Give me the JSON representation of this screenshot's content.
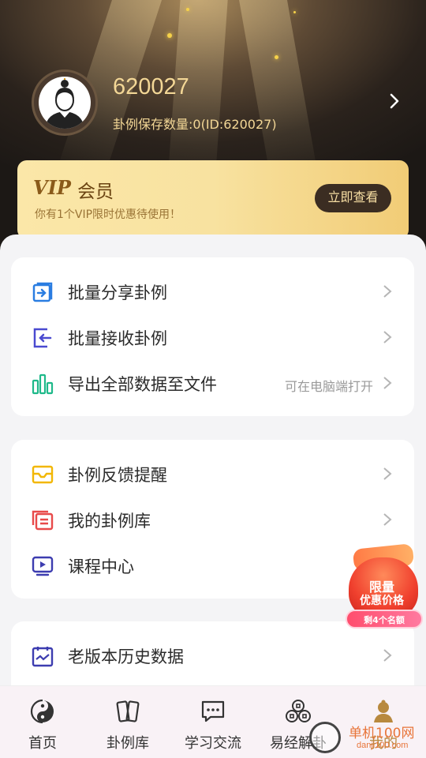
{
  "profile": {
    "username": "620027",
    "saved_info": "卦例保存数量:0(ID:620027)"
  },
  "vip": {
    "logo": "VIP",
    "title": "会员",
    "subtitle": "你有1个VIP限时优惠待使用！",
    "button_label": "立即查看"
  },
  "menu_group1": [
    {
      "label": "批量分享卦例",
      "hint": ""
    },
    {
      "label": "批量接收卦例",
      "hint": ""
    },
    {
      "label": "导出全部数据至文件",
      "hint": "可在电脑端打开"
    }
  ],
  "menu_group2": [
    {
      "label": "卦例反馈提醒"
    },
    {
      "label": "我的卦例库"
    },
    {
      "label": "课程中心"
    }
  ],
  "menu_group3": [
    {
      "label": "老版本历史数据"
    }
  ],
  "promo": {
    "line1": "限量",
    "line2": "优惠价格",
    "pill": "剩4个名额"
  },
  "tabs": [
    {
      "label": "首页",
      "icon": "taiji-icon"
    },
    {
      "label": "卦例库",
      "icon": "cards-icon"
    },
    {
      "label": "学习交流",
      "icon": "chat-icon"
    },
    {
      "label": "易经解卦",
      "icon": "coins-icon"
    },
    {
      "label": "我的",
      "icon": "person-icon",
      "active": true
    }
  ],
  "watermark": {
    "title": "单机100网",
    "url": "danji100.com"
  },
  "colors": {
    "accent_gold": "#f3d796",
    "vip_dark": "#3b2d22",
    "tab_active": "#b8893e"
  }
}
